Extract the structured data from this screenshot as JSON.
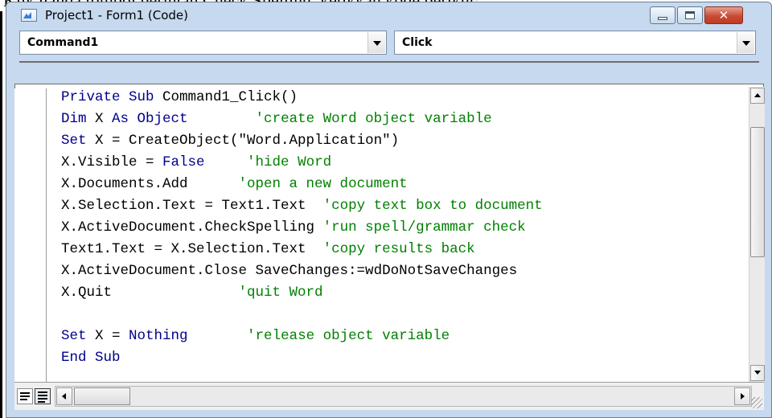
{
  "background_text": "Klik ganda tombol perintah Check Spelling, ketikkan kode berikut:",
  "window": {
    "title": "Project1 - Form1 (Code)",
    "close_glyph": "✕"
  },
  "object_combo": {
    "value": "Command1"
  },
  "procedure_combo": {
    "value": "Click"
  },
  "code_lines": [
    [
      {
        "t": "kw",
        "s": "Private Sub "
      },
      {
        "t": "tx",
        "s": "Command1_Click()"
      }
    ],
    [
      {
        "t": "kw",
        "s": "Dim "
      },
      {
        "t": "tx",
        "s": "X "
      },
      {
        "t": "kw",
        "s": "As Object"
      },
      {
        "t": "cm",
        "s": "        'create Word object variable"
      }
    ],
    [
      {
        "t": "kw",
        "s": "Set "
      },
      {
        "t": "tx",
        "s": "X = CreateObject(\"Word.Application\")"
      }
    ],
    [
      {
        "t": "tx",
        "s": "X.Visible = "
      },
      {
        "t": "kw",
        "s": "False"
      },
      {
        "t": "cm",
        "s": "     'hide Word"
      }
    ],
    [
      {
        "t": "tx",
        "s": "X.Documents.Add"
      },
      {
        "t": "cm",
        "s": "      'open a new document"
      }
    ],
    [
      {
        "t": "tx",
        "s": "X.Selection.Text = Text1.Text"
      },
      {
        "t": "cm",
        "s": "  'copy text box to document"
      }
    ],
    [
      {
        "t": "tx",
        "s": "X.ActiveDocument.CheckSpelling"
      },
      {
        "t": "cm",
        "s": " 'run spell/grammar check"
      }
    ],
    [
      {
        "t": "tx",
        "s": "Text1.Text = X.Selection.Text"
      },
      {
        "t": "cm",
        "s": "  'copy results back"
      }
    ],
    [
      {
        "t": "tx",
        "s": "X.ActiveDocument.Close SaveChanges:=wdDoNotSaveChanges"
      }
    ],
    [
      {
        "t": "tx",
        "s": "X.Quit"
      },
      {
        "t": "cm",
        "s": "               'quit Word"
      }
    ],
    [],
    [
      {
        "t": "kw",
        "s": "Set "
      },
      {
        "t": "tx",
        "s": "X = "
      },
      {
        "t": "kw",
        "s": "Nothing"
      },
      {
        "t": "cm",
        "s": "       'release object variable"
      }
    ],
    [
      {
        "t": "kw",
        "s": "End Sub"
      }
    ]
  ],
  "icons": {
    "app": "vb-form-icon",
    "minimize": "minimize-icon",
    "maximize": "maximize-icon",
    "close": "close-icon",
    "dropdown": "chevron-down-icon",
    "scroll_up": "arrow-up-icon",
    "scroll_down": "arrow-down-icon",
    "scroll_left": "arrow-left-icon",
    "scroll_right": "arrow-right-icon",
    "procedure_view": "procedure-view-icon",
    "full_module_view": "full-module-view-icon"
  },
  "colors": {
    "keyword": "#00008b",
    "comment": "#008000",
    "text": "#000000",
    "window_frame": "#c6d9ee",
    "close_button": "#c74c35"
  }
}
